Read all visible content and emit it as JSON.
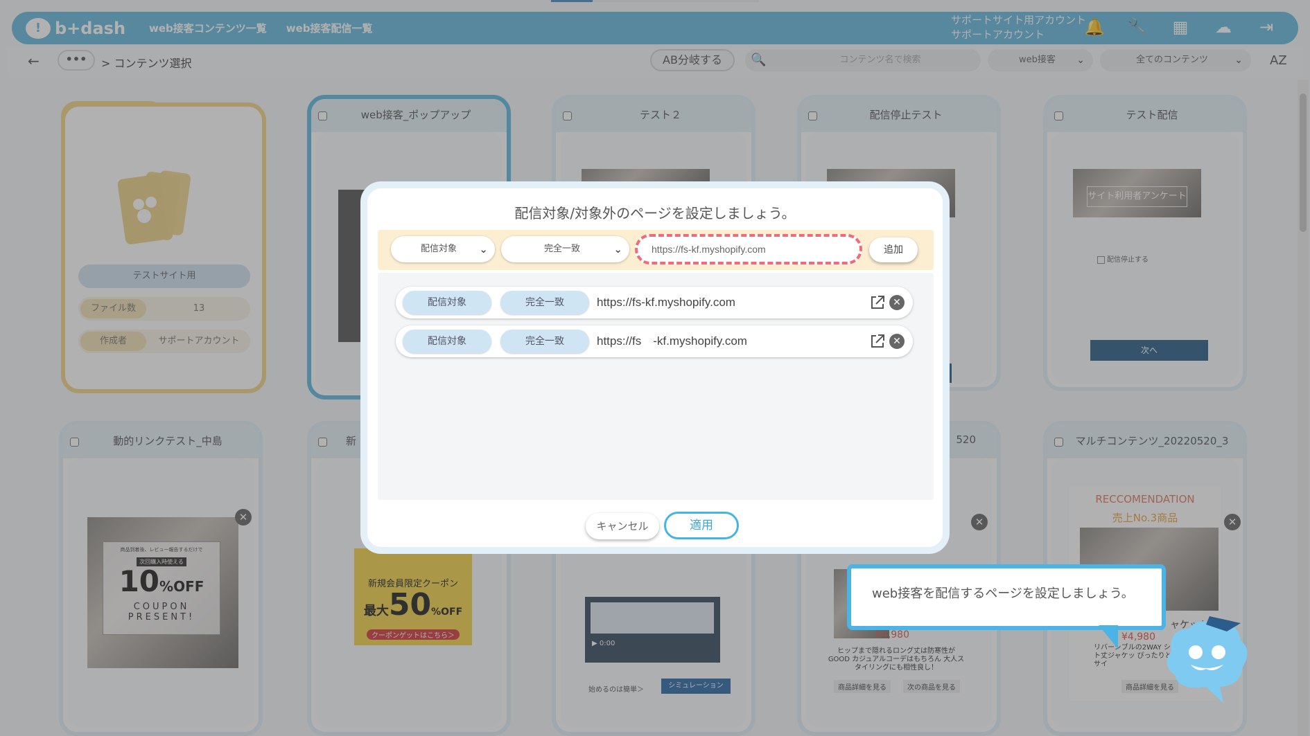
{
  "header": {
    "logo": "b+dash",
    "nav": [
      "web接客コンテンツ一覧",
      "web接客配信一覧"
    ],
    "account_line1": "サポートサイト用アカウント",
    "account_line2": "サポートアカウント"
  },
  "toolbar": {
    "dots": "•••",
    "breadcrumb": "> コンテンツ選択",
    "ab_button": "AB分岐する",
    "search_placeholder": "コンテンツ名で検索",
    "type_select": "web接客",
    "filter_select": "全てのコンテンツ",
    "sort": "AZ"
  },
  "folder": {
    "name": "テストサイト用",
    "file_count_label": "ファイル数",
    "file_count": "13",
    "creator_label": "作成者",
    "creator": "サポートアカウント"
  },
  "cards": [
    {
      "title": "web接客_ポップアップ"
    },
    {
      "title": "テスト２"
    },
    {
      "title": "配信停止テスト"
    },
    {
      "title": "テスト配信",
      "thumb_text": "サイト利用者アンケート",
      "checkbox_label": "配信停止する",
      "button": "次へ"
    },
    {
      "title": "動的リンクテスト_中島",
      "coupon_small": "商品到着後、レビュー報告するだけで",
      "coupon_tag": "次回購入時使える",
      "coupon_big": "10",
      "coupon_unit": "%OFF",
      "coupon_sub": "COUPON PRESENT!"
    },
    {
      "title": "新",
      "coupon_head": "新規会員限定クーポン",
      "coupon_pre": "最大",
      "coupon_num": "50",
      "coupon_unit": "%OFF",
      "coupon_btn": "クーポンゲットはこちら＞"
    },
    {
      "title": "",
      "video_time": "0:00",
      "footer_text": "始めるのは簡単＞",
      "footer_btn": "シミュレーション"
    },
    {
      "title": "520",
      "price": "¥4,980",
      "desc": "ヒップまで隠れるロング丈は防寒性がGOOD カジュアルコーデはもちろん 大人スタイリングにも相性良し！",
      "btn1": "商品詳細を見る",
      "btn2": "次の商品を見る"
    },
    {
      "title": "マルチコンテンツ_20220520_3",
      "reco": "RECCOMENDATION",
      "reco_sub": "売上No.3商品",
      "price": "¥4,980",
      "jacket": "ャケット",
      "desc": "リバーシブルの2WAY ショート丈ジャケッ ぴったりとしたサイ",
      "btn1": "商品詳細を見る"
    }
  ],
  "modal": {
    "title": "配信対象/対象外のページを設定しましょう。",
    "target_select": "配信対象",
    "match_select": "完全一致",
    "url_input": "https://fs-kf.myshopify.com",
    "add_button": "追加",
    "rules": [
      {
        "target": "配信対象",
        "match": "完全一致",
        "url": "https://fs-kf.myshopify.com"
      },
      {
        "target": "配信対象",
        "match": "完全一致",
        "url": "https://fs　-kf.myshopify.com"
      }
    ],
    "cancel": "キャンセル",
    "apply": "適用"
  },
  "tooltip": "web接客を配信するページを設定しましょう。",
  "colors": {
    "nav": "#67b8dd",
    "accent": "#45b4e5",
    "highlight": "#f06a7c",
    "folder": "#f3d58b"
  }
}
